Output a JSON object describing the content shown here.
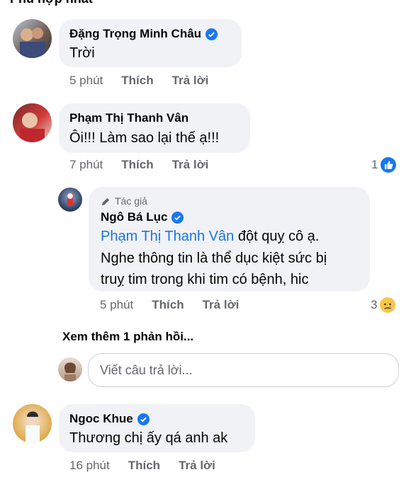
{
  "header": {
    "title": "Phù hợp nhất"
  },
  "comments": [
    {
      "name": "Đặng Trọng Minh Châu",
      "text": "Trời",
      "time": "5 phút",
      "like": "Thích",
      "reply": "Trả lời"
    },
    {
      "name": "Phạm Thị Thanh Vân",
      "text": "Ôi!!! Làm sao lại thế ạ!!!",
      "time": "7 phút",
      "like": "Thích",
      "reply": "Trả lời",
      "reaction_count": "1"
    }
  ],
  "reply": {
    "author_badge": "Tác giả",
    "name": "Ngô Bá Lục",
    "mention": "Phạm Thị Thanh Vân",
    "line1_rest": " đột quỵ cô ạ.",
    "line2": "Nghe thông tin là thể dục kiệt sức bị",
    "line3": "truỵ tim trong khi tim có bệnh, hic",
    "time": "5 phút",
    "like": "Thích",
    "reply": "Trả lời",
    "reaction_count": "3"
  },
  "more_replies": "Xem thêm 1 phản hồi...",
  "reply_input": {
    "placeholder": "Viết câu trả lời..."
  },
  "last_comment": {
    "name": "Ngoc Khue",
    "text": "Thương chị ấy qá anh ak",
    "time": "16 phút",
    "like": "Thích",
    "reply": "Trả lời"
  },
  "colors": {
    "like_blue": "#1877f2",
    "link": "#1b74e4",
    "bubble": "#f0f2f5",
    "meta": "#65676b"
  }
}
